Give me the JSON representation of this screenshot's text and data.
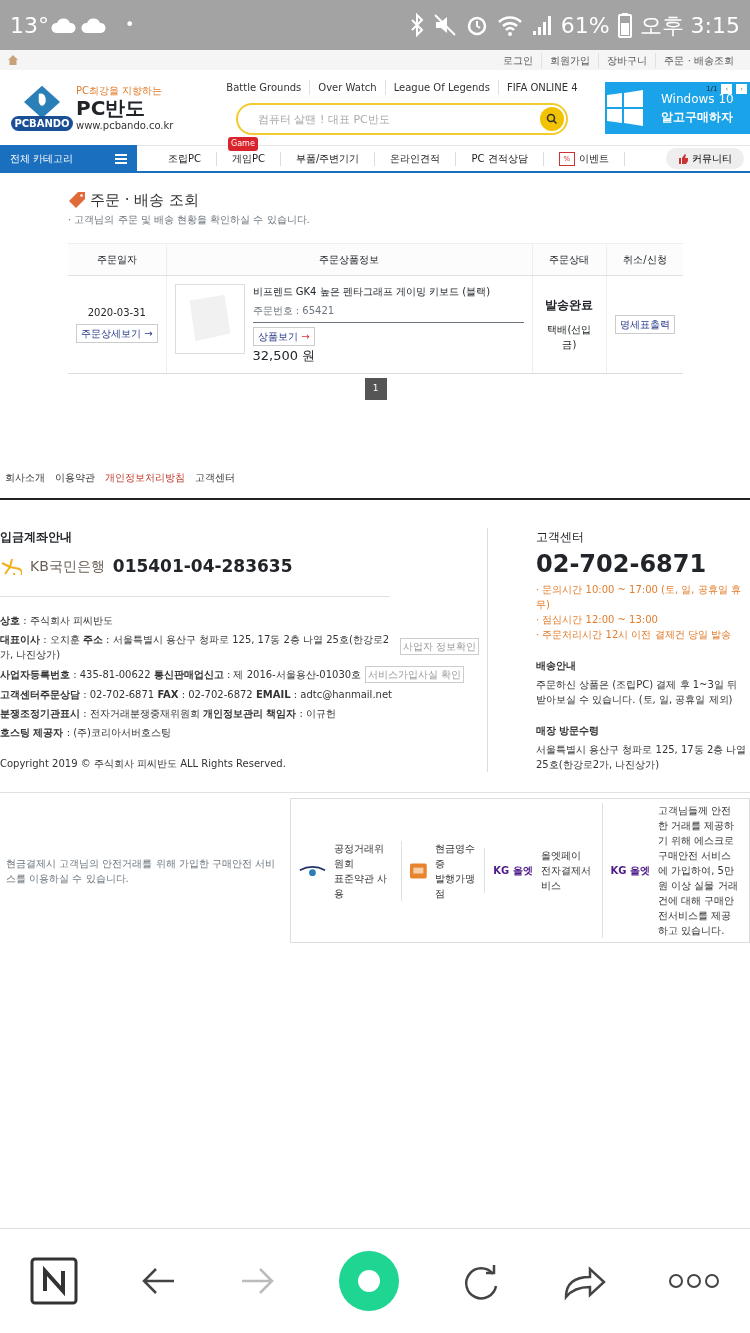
{
  "status_bar": {
    "temperature": "13°",
    "dot": "•",
    "battery": "61%",
    "time": "오후 3:15"
  },
  "top_links": [
    "로그인",
    "회원가입",
    "장바구니",
    "주문 · 배송조회"
  ],
  "logo": {
    "tagline": "PC최강을 지향하는",
    "name": "PC반도",
    "badge": "PCBANDO",
    "url": "www.pcbando.co.kr"
  },
  "quick_links": [
    "Battle Grounds",
    "Over Watch",
    "League Of Legends",
    "FIFA ONLINE 4"
  ],
  "search": {
    "placeholder": "컴퓨터 살땐 ! 대표 PC반도"
  },
  "banner": {
    "counter": "1/1",
    "prev": "‹",
    "next": "›",
    "title": "Windows 10",
    "subtitle": "알고구매하자"
  },
  "nav": {
    "category": "전체 카테고리",
    "items": [
      {
        "label": "조립PC"
      },
      {
        "label": "게임PC",
        "badge": "Game"
      },
      {
        "label": "부품/주변기기"
      },
      {
        "label": "온라인견적"
      },
      {
        "label": "PC 견적상담"
      },
      {
        "label": "이벤트",
        "kind": "event",
        "icon_text": "%"
      }
    ],
    "community": "커뮤니티"
  },
  "page": {
    "title": "주문 · 배송 조회",
    "subtitle": "· 고객님의 주문 및 배송 현황을 확인하실 수 있습니다."
  },
  "table": {
    "columns": [
      "주문일자",
      "주문상품정보",
      "주문상태",
      "취소/신청"
    ],
    "rows": [
      {
        "date": "2020-03-31",
        "detail_button": "주문상세보기 →",
        "product": "비프렌드 GK4 높은 펜타그래프 게이밍 키보드 (블랙)",
        "order_no": "주문번호 : 65421",
        "view_button": "상품보기",
        "view_arrow": "→",
        "price": "32,500 원",
        "status": "발송완료",
        "shipping": "택배(선입금)",
        "action": "명세표출력"
      }
    ]
  },
  "pagination": [
    {
      "label": "1",
      "selected": true
    }
  ],
  "footer_links": [
    {
      "label": "회사소개",
      "highlight": false
    },
    {
      "label": "이용약관",
      "highlight": false
    },
    {
      "label": "개인정보처리방침",
      "highlight": true
    },
    {
      "label": "고객센터",
      "highlight": false
    }
  ],
  "account": {
    "title": "입금계좌안내",
    "bank": "KB국민은행",
    "number": "015401-04-283635"
  },
  "company": [
    {
      "label": "상호",
      "value": ": 주식회사 피씨반도"
    },
    {
      "label": "대표이사",
      "value": ": 오치훈",
      "label2": "주소",
      "value2": ": 서울특별시 용산구 청파로 125, 17동 2층 나열 25호(한강로2가, 나진상가)",
      "button": "사업자 정보확인"
    },
    {
      "label": "사업자등록번호",
      "value": ": 435-81-00622",
      "label2": "통신판매업신고",
      "value2": ": 제 2016-서울용산-01030호",
      "button": "서비스가입사실 확인"
    },
    {
      "label": "고객센터주문상담",
      "value": ": 02-702-6871",
      "label2": "FAX",
      "value2": ": 02-702-6872",
      "label3": "EMAIL",
      "value3": ": adtc@hanmail.net"
    },
    {
      "label": "분쟁조정기관표시",
      "value": ": 전자거래분쟁중재위원회",
      "label2": "개인정보관리 책임자",
      "value2": ": 이규헌"
    },
    {
      "label": "호스팅 제공자",
      "value": ": (주)코리아서버호스팅"
    }
  ],
  "copyright": "Copyright 2019 © 주식회사 피씨반도 ALL Rights Reserved.",
  "support": {
    "title": "고객센터",
    "phone": "02-702-6871",
    "hours": [
      "· 문의시간 10:00 ~ 17:00 (토, 일, 공휴일 휴무)",
      "· 점심시간 12:00 ~ 13:00",
      "· 주문처리시간 12시 이전 결제건 당일 발송"
    ],
    "sections": [
      {
        "title": "배송안내",
        "text": "주문하신 상품은 (조립PC) 결제 후 1~3일 뒤 받아보실 수 있습니다. (토, 일, 공휴일 제외)"
      },
      {
        "title": "매장 방문수령",
        "text": "서울특별시 용산구 청파로 125, 17동 2층 나열 25호(한강로2가, 나진상가)"
      }
    ]
  },
  "escrow_note": "현금결제시 고객님의 안전거래를 위해 가입한 구매안전 서비스를 이용하실 수 있습니다.",
  "certs": [
    {
      "kind": "ftc",
      "text": "공정거래위원회\n표준약관 사용"
    },
    {
      "kind": "receipt",
      "text": "현금영수증\n발행가맹점"
    },
    {
      "kind": "kg",
      "brand": "KG 올엣",
      "text": "올엣페이\n전자결제서비스"
    },
    {
      "kind": "kg",
      "brand": "KG 올엣",
      "text": "고객님들께 안전한 거래를 제공하기 위해 에스크로 구매안전 서비스에 가입하여, 5만원 이상 실물 거래건에 대해 구매안전서비스를 제공하고 있습니다."
    }
  ]
}
